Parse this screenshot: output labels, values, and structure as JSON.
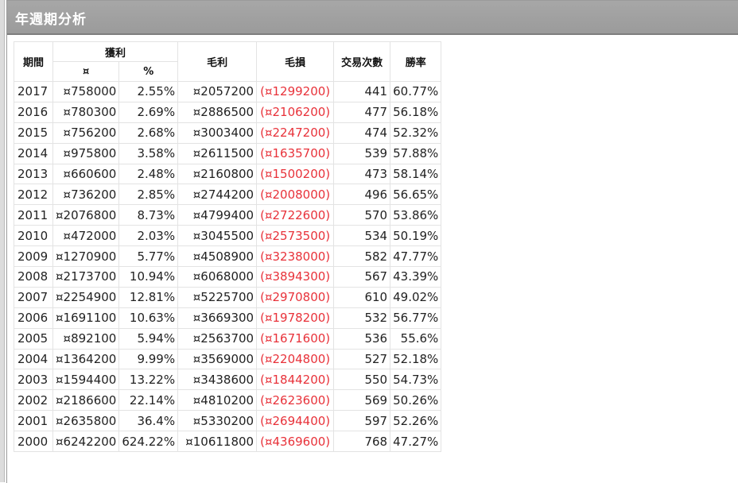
{
  "panel": {
    "title": "年週期分析"
  },
  "table": {
    "headers": {
      "period": "期間",
      "profit": "獲利",
      "profit_amount": "¤",
      "profit_pct": "%",
      "gross_profit": "毛利",
      "gross_loss": "毛損",
      "trades": "交易次數",
      "win_rate": "勝率"
    },
    "rows": [
      {
        "year": "2017",
        "amount": "¤758000",
        "pct": "2.55%",
        "gross_profit": "¤2057200",
        "gross_loss": "(¤1299200)",
        "trades": "441",
        "win_rate": "60.77%"
      },
      {
        "year": "2016",
        "amount": "¤780300",
        "pct": "2.69%",
        "gross_profit": "¤2886500",
        "gross_loss": "(¤2106200)",
        "trades": "477",
        "win_rate": "56.18%"
      },
      {
        "year": "2015",
        "amount": "¤756200",
        "pct": "2.68%",
        "gross_profit": "¤3003400",
        "gross_loss": "(¤2247200)",
        "trades": "474",
        "win_rate": "52.32%"
      },
      {
        "year": "2014",
        "amount": "¤975800",
        "pct": "3.58%",
        "gross_profit": "¤2611500",
        "gross_loss": "(¤1635700)",
        "trades": "539",
        "win_rate": "57.88%"
      },
      {
        "year": "2013",
        "amount": "¤660600",
        "pct": "2.48%",
        "gross_profit": "¤2160800",
        "gross_loss": "(¤1500200)",
        "trades": "473",
        "win_rate": "58.14%"
      },
      {
        "year": "2012",
        "amount": "¤736200",
        "pct": "2.85%",
        "gross_profit": "¤2744200",
        "gross_loss": "(¤2008000)",
        "trades": "496",
        "win_rate": "56.65%"
      },
      {
        "year": "2011",
        "amount": "¤2076800",
        "pct": "8.73%",
        "gross_profit": "¤4799400",
        "gross_loss": "(¤2722600)",
        "trades": "570",
        "win_rate": "53.86%"
      },
      {
        "year": "2010",
        "amount": "¤472000",
        "pct": "2.03%",
        "gross_profit": "¤3045500",
        "gross_loss": "(¤2573500)",
        "trades": "534",
        "win_rate": "50.19%"
      },
      {
        "year": "2009",
        "amount": "¤1270900",
        "pct": "5.77%",
        "gross_profit": "¤4508900",
        "gross_loss": "(¤3238000)",
        "trades": "582",
        "win_rate": "47.77%"
      },
      {
        "year": "2008",
        "amount": "¤2173700",
        "pct": "10.94%",
        "gross_profit": "¤6068000",
        "gross_loss": "(¤3894300)",
        "trades": "567",
        "win_rate": "43.39%"
      },
      {
        "year": "2007",
        "amount": "¤2254900",
        "pct": "12.81%",
        "gross_profit": "¤5225700",
        "gross_loss": "(¤2970800)",
        "trades": "610",
        "win_rate": "49.02%"
      },
      {
        "year": "2006",
        "amount": "¤1691100",
        "pct": "10.63%",
        "gross_profit": "¤3669300",
        "gross_loss": "(¤1978200)",
        "trades": "532",
        "win_rate": "56.77%"
      },
      {
        "year": "2005",
        "amount": "¤892100",
        "pct": "5.94%",
        "gross_profit": "¤2563700",
        "gross_loss": "(¤1671600)",
        "trades": "536",
        "win_rate": "55.6%"
      },
      {
        "year": "2004",
        "amount": "¤1364200",
        "pct": "9.99%",
        "gross_profit": "¤3569000",
        "gross_loss": "(¤2204800)",
        "trades": "527",
        "win_rate": "52.18%"
      },
      {
        "year": "2003",
        "amount": "¤1594400",
        "pct": "13.22%",
        "gross_profit": "¤3438600",
        "gross_loss": "(¤1844200)",
        "trades": "550",
        "win_rate": "54.73%"
      },
      {
        "year": "2002",
        "amount": "¤2186600",
        "pct": "22.14%",
        "gross_profit": "¤4810200",
        "gross_loss": "(¤2623600)",
        "trades": "569",
        "win_rate": "50.26%"
      },
      {
        "year": "2001",
        "amount": "¤2635800",
        "pct": "36.4%",
        "gross_profit": "¤5330200",
        "gross_loss": "(¤2694400)",
        "trades": "597",
        "win_rate": "52.26%"
      },
      {
        "year": "2000",
        "amount": "¤6242200",
        "pct": "624.22%",
        "gross_profit": "¤10611800",
        "gross_loss": "(¤4369600)",
        "trades": "768",
        "win_rate": "47.27%"
      }
    ]
  },
  "colors": {
    "header_bg": "#a0a0a0",
    "loss_text": "#e8323a"
  }
}
